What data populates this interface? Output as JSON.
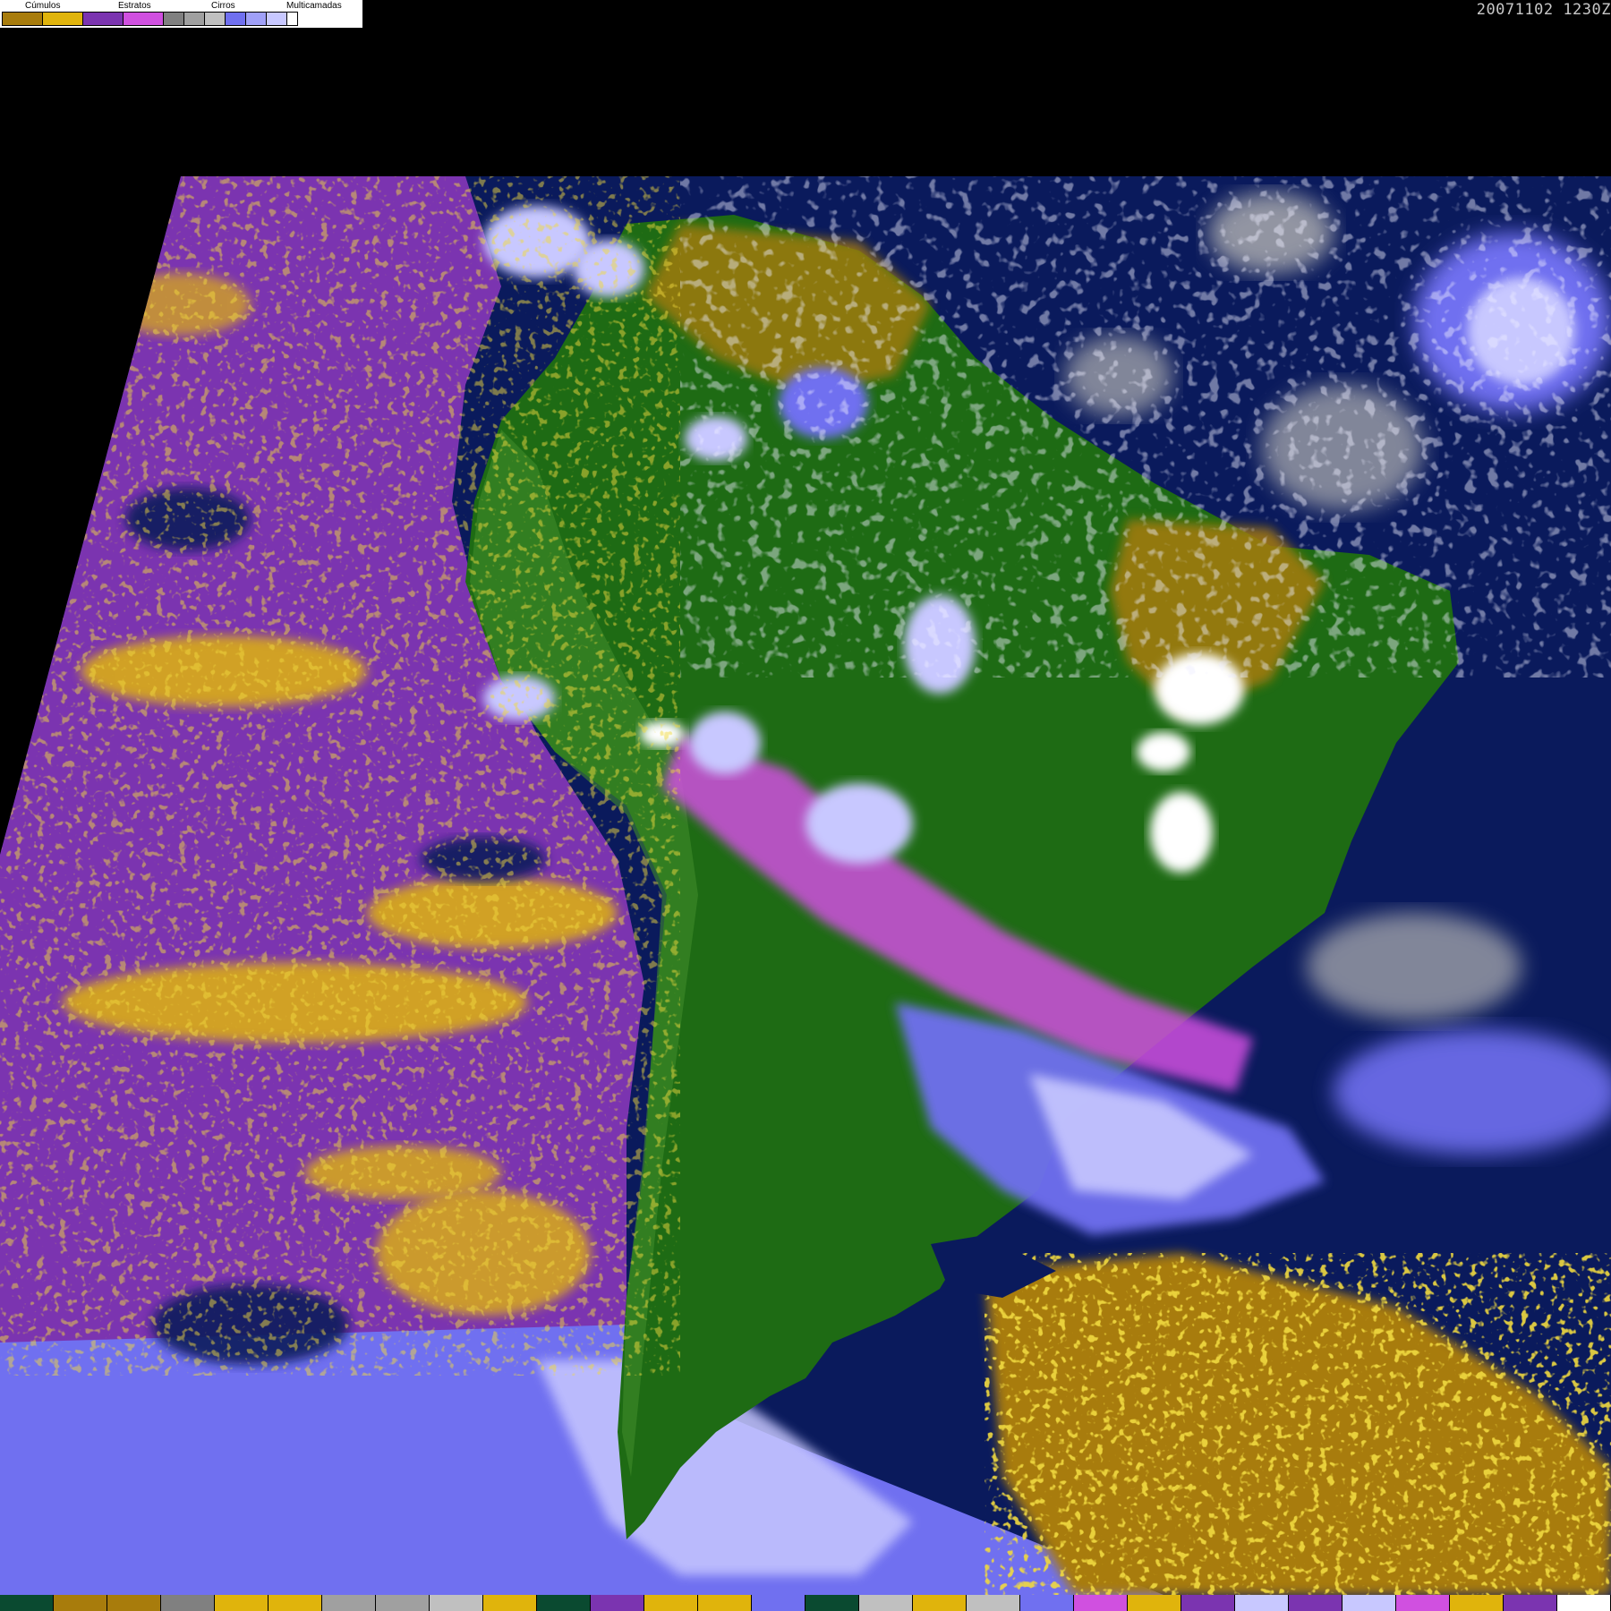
{
  "timestamp": "20071102 1230Z",
  "legend": {
    "categories": [
      {
        "label": "Cúmulos",
        "colors": [
          "#a87c0c",
          "#e0b40c"
        ]
      },
      {
        "label": "Estratos",
        "colors": [
          "#7b34b0",
          "#d050e0"
        ]
      },
      {
        "label": "Cirros",
        "colors": [
          "#808080",
          "#a0a0a0",
          "#c0c0c0"
        ]
      },
      {
        "label": "Multicamadas",
        "colors": [
          "#7070f0",
          "#a0a0f8",
          "#c8c8ff",
          "#ffffff"
        ]
      }
    ]
  },
  "map": {
    "colors": {
      "ocean": "#0a1a5c",
      "land": "#1e6b14",
      "land_light": "#3f8a2a",
      "stratus": "#7b34b0",
      "stratus_bright": "#d050e0",
      "cumulus_dark": "#a87c0c",
      "cumulus": "#e0b40c",
      "cirrus": "#b4b4b4",
      "multilayer": "#7070f0",
      "multilayer_light": "#c8c8ff",
      "white": "#ffffff"
    }
  },
  "bottom_strip": {
    "colors": [
      "#0a4a30",
      "#a87c0c",
      "#a87c0c",
      "#808080",
      "#e0b40c",
      "#e0b40c",
      "#a0a0a0",
      "#a0a0a0",
      "#c0c0c0",
      "#e0b40c",
      "#0a4a30",
      "#7b34b0",
      "#e0b40c",
      "#e0b40c",
      "#7070f0",
      "#0a4a30",
      "#c0c0c0",
      "#e0b40c",
      "#c0c0c0",
      "#7070f0",
      "#d050e0",
      "#e0b40c",
      "#7b34b0",
      "#c8c8ff",
      "#7b34b0",
      "#c8c8ff",
      "#d050e0",
      "#e0b40c",
      "#7b34b0",
      "#ffffff"
    ]
  }
}
